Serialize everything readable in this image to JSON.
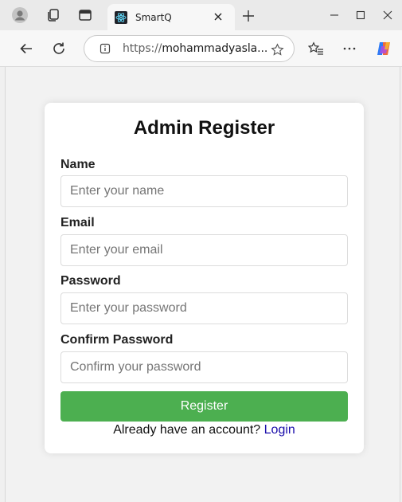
{
  "browser": {
    "tab_title": "SmartQ",
    "url_protocol": "https://",
    "url_host": "mohammadyasla...",
    "colors": {
      "titlebar": "#eaeaea",
      "toolbar": "#f7f7f7"
    }
  },
  "form": {
    "title": "Admin Register",
    "fields": [
      {
        "label": "Name",
        "placeholder": "Enter your name",
        "value": ""
      },
      {
        "label": "Email",
        "placeholder": "Enter your email",
        "value": ""
      },
      {
        "label": "Password",
        "placeholder": "Enter your password",
        "value": ""
      },
      {
        "label": "Confirm Password",
        "placeholder": "Confirm your password",
        "value": ""
      }
    ],
    "submit_label": "Register",
    "footer_text": "Already have an account?",
    "login_link": "Login",
    "colors": {
      "button": "#4caf50",
      "link": "#1a0dab"
    }
  }
}
